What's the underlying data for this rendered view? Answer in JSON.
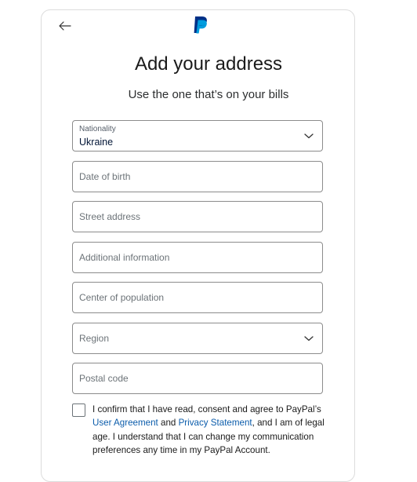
{
  "header": {
    "back_icon": "arrow-left-icon",
    "logo_icon": "paypal-logo-icon",
    "title": "Add your address",
    "subtitle": "Use the one that’s on your bills"
  },
  "form": {
    "nationality": {
      "label": "Nationality",
      "value": "Ukraine",
      "icon": "chevron-down-icon"
    },
    "date_of_birth": {
      "placeholder": "Date of birth"
    },
    "street_address": {
      "placeholder": "Street address"
    },
    "additional_info": {
      "placeholder": "Additional information"
    },
    "center_of_population": {
      "placeholder": "Center of population"
    },
    "region": {
      "placeholder": "Region",
      "icon": "chevron-down-icon"
    },
    "postal_code": {
      "placeholder": "Postal code"
    }
  },
  "consent": {
    "checked": false,
    "text_1": "I confirm that I have read, consent and agree to PayPal’s ",
    "link_user_agreement": "User Agreement",
    "text_2": " and ",
    "link_privacy": "Privacy Statement",
    "text_3": ", and I am of legal age. I understand that I can change my communication preferences any time in my PayPal Account."
  },
  "colors": {
    "paypal_dark_blue": "#003087",
    "paypal_light_blue": "#009cde",
    "link": "#0b5cab"
  }
}
